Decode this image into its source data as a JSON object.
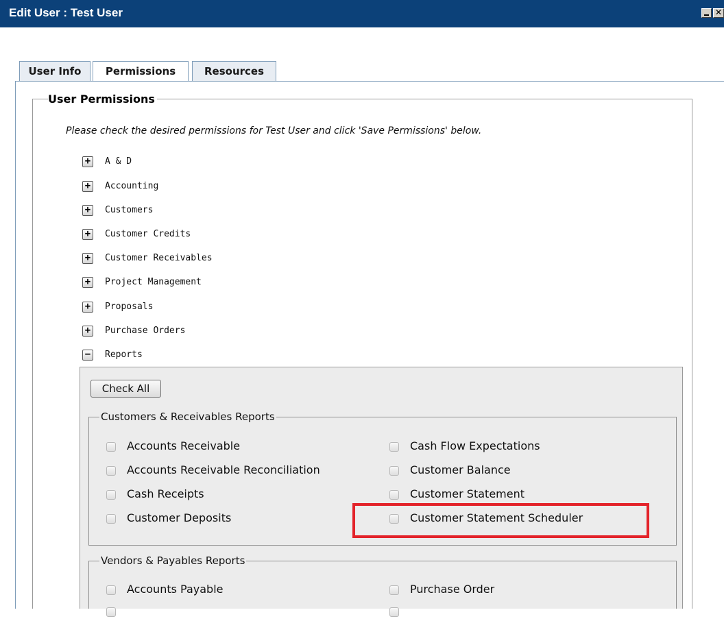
{
  "window": {
    "title": "Edit User : Test User"
  },
  "tabs": {
    "user_info": "User Info",
    "permissions": "Permissions",
    "resources": "Resources"
  },
  "user_permissions": {
    "legend": "User Permissions",
    "instructions": "Please check the desired permissions for Test User and click 'Save Permissions' below."
  },
  "tree": [
    {
      "label": "A & D",
      "symbol": "+"
    },
    {
      "label": "Accounting",
      "symbol": "+"
    },
    {
      "label": "Customers",
      "symbol": "+"
    },
    {
      "label": "Customer Credits",
      "symbol": "+"
    },
    {
      "label": "Customer Receivables",
      "symbol": "+"
    },
    {
      "label": "Project Management",
      "symbol": "+"
    },
    {
      "label": "Proposals",
      "symbol": "+"
    },
    {
      "label": "Purchase Orders",
      "symbol": "+"
    },
    {
      "label": "Reports",
      "symbol": "−"
    }
  ],
  "reports": {
    "check_all": "Check All",
    "customers_receivables": {
      "legend": "Customers & Receivables Reports",
      "left": [
        "Accounts Receivable",
        "Accounts Receivable Reconciliation",
        "Cash Receipts",
        "Customer Deposits"
      ],
      "right": [
        "Cash Flow Expectations",
        "Customer Balance",
        "Customer Statement",
        "Customer Statement Scheduler"
      ]
    },
    "vendors_payables": {
      "legend": "Vendors & Payables Reports",
      "left": [
        "Accounts Payable"
      ],
      "right": [
        "Purchase Order"
      ]
    }
  },
  "colors": {
    "titlebar": "#0c4179",
    "highlight": "#e3232a"
  }
}
